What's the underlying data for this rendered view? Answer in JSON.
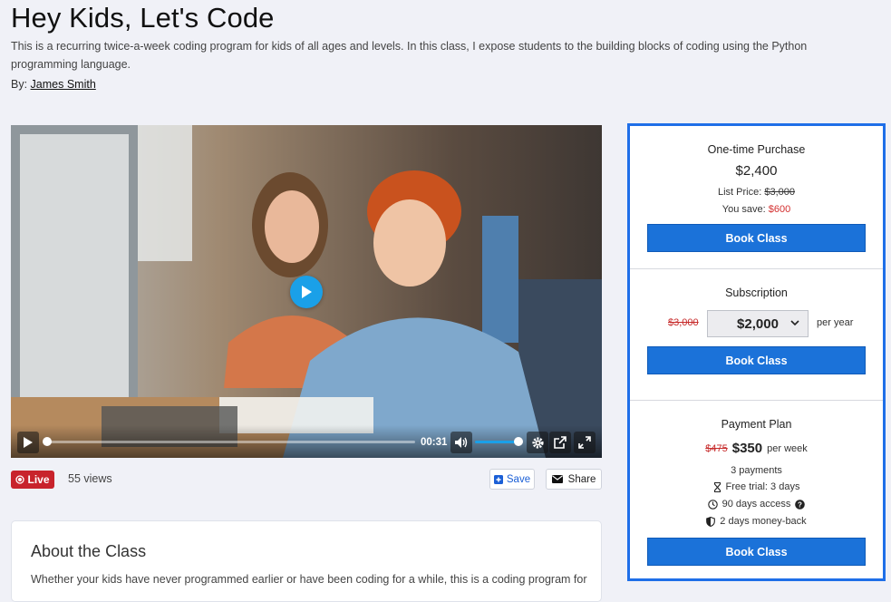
{
  "header": {
    "title": "Hey Kids, Let's Code",
    "description": "This is a recurring twice-a-week coding program for kids of all ages and levels. In this class, I expose students to the building blocks of coding using the Python programming language.",
    "by_label": "By:",
    "author": "James Smith"
  },
  "video": {
    "time": "00:31",
    "volume_percent": 100,
    "progress_percent": 0
  },
  "meta": {
    "live_label": "Live",
    "views": "55 views",
    "save_label": "Save",
    "share_label": "Share"
  },
  "about": {
    "title": "About the Class",
    "text": "Whether your kids have never programmed earlier or have been coding for a while, this is a coding program for"
  },
  "pricing": {
    "one_time": {
      "title": "One-time Purchase",
      "price": "$2,400",
      "list_price_label": "List Price:",
      "list_price": "$3,000",
      "save_label": "You save:",
      "save_amount": "$600",
      "button": "Book Class"
    },
    "subscription": {
      "title": "Subscription",
      "old_price": "$3,000",
      "selected_price": "$2,000",
      "period": "per year",
      "button": "Book Class"
    },
    "payment_plan": {
      "title": "Payment Plan",
      "old_price": "$475",
      "price": "$350",
      "period": "per week",
      "payments": "3 payments",
      "free_trial": "Free trial: 3 days",
      "access": "90 days access",
      "money_back": "2 days money-back",
      "button": "Book Class"
    }
  },
  "colors": {
    "accent": "#1b72d9",
    "panel_border": "#1f6fe8",
    "live": "#c8232c",
    "strike_red": "#c62828",
    "play_blue": "#1aa0e8"
  },
  "icons": [
    "play-icon",
    "volume-icon",
    "settings-icon",
    "popout-icon",
    "fullscreen-icon",
    "live-dot-icon",
    "save-icon",
    "mail-icon",
    "chevron-down-icon",
    "hourglass-icon",
    "clock-icon",
    "help-icon",
    "shield-icon"
  ]
}
